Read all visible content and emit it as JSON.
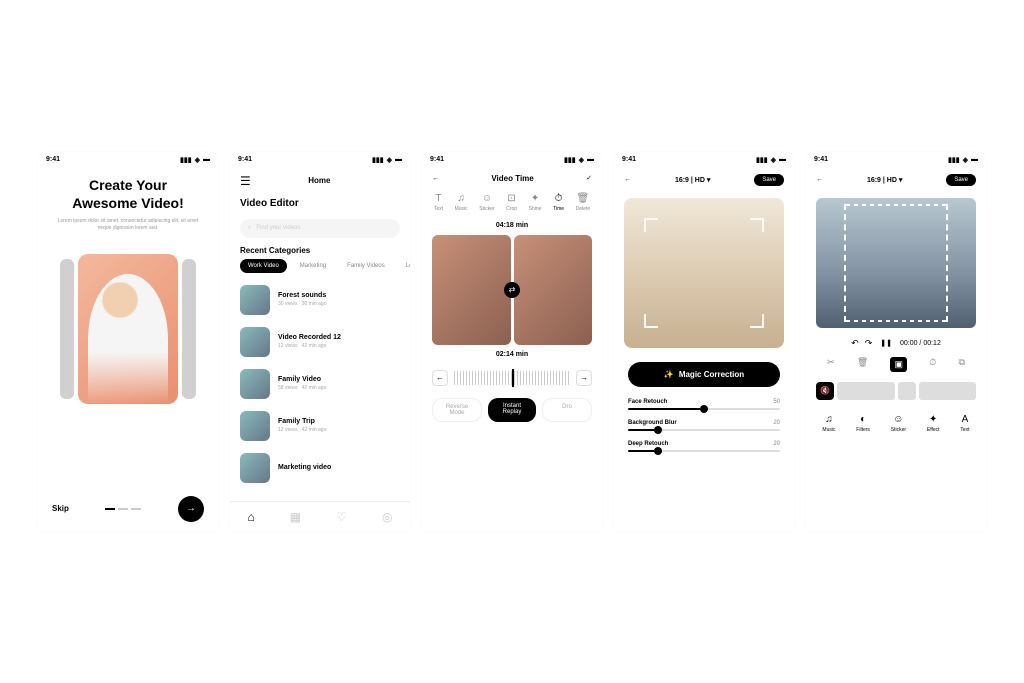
{
  "status_time": "9:41",
  "screen1": {
    "title_line1": "Create Your",
    "title_line2": "Awesome Video!",
    "subtitle": "Lorem ipsum dolor sit amet, consectetur adipiscing elit, sit amet neque dignissim lorem sed.",
    "skip": "Skip"
  },
  "screen2": {
    "header": "Home",
    "section": "Video Editor",
    "search_placeholder": "Find your videos",
    "categories_label": "Recent Categories",
    "chips": [
      "Work Video",
      "Marketing",
      "Family Videos",
      "Lo"
    ],
    "items": [
      {
        "title": "Forest sounds",
        "views": "30 views",
        "ago": "30 min ago"
      },
      {
        "title": "Video Recorded 12",
        "views": "12 views",
        "ago": "42 min ago"
      },
      {
        "title": "Family Video",
        "views": "58 views",
        "ago": "42 min ago"
      },
      {
        "title": "Family Trip",
        "views": "12 views",
        "ago": "42 min ago"
      },
      {
        "title": "Marketing video",
        "views": "",
        "ago": ""
      }
    ]
  },
  "screen3": {
    "header": "Video Time",
    "tools": [
      {
        "icon": "T",
        "label": "Text"
      },
      {
        "icon": "♫",
        "label": "Music"
      },
      {
        "icon": "☺",
        "label": "Sticker"
      },
      {
        "icon": "⊡",
        "label": "Crop"
      },
      {
        "icon": "✦",
        "label": "Shine"
      },
      {
        "icon": "⏱",
        "label": "Time"
      },
      {
        "icon": "🗑",
        "label": "Delete"
      }
    ],
    "total_time": "04:18 min",
    "current_time": "02:14 min",
    "modes": [
      "Reverse Mode",
      "Instant Replay",
      "Dro"
    ]
  },
  "screen4": {
    "ratio": "16:9 | HD ▾",
    "save": "Save",
    "magic": "Magic Correction",
    "sliders": [
      {
        "label": "Face Retouch",
        "value": 50
      },
      {
        "label": "Background Blur",
        "value": 20
      },
      {
        "label": "Deep Retouch",
        "value": 20
      }
    ]
  },
  "screen5": {
    "ratio": "16:9 | HD ▾",
    "save": "Save",
    "time": "00:00 / 00:12",
    "bottom_tools": [
      {
        "icon": "♫",
        "label": "Music"
      },
      {
        "icon": "◐",
        "label": "Filters"
      },
      {
        "icon": "☺",
        "label": "Sticker"
      },
      {
        "icon": "✦",
        "label": "Effect"
      },
      {
        "icon": "A",
        "label": "Text"
      }
    ]
  }
}
